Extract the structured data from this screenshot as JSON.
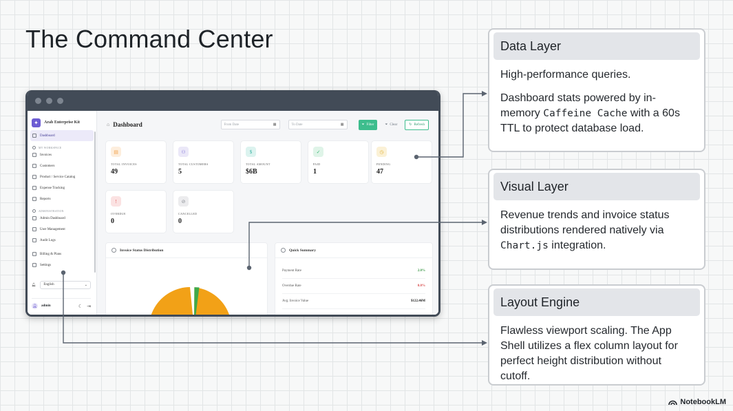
{
  "slide": {
    "title": "The Command Center",
    "watermark": "NotebookLM"
  },
  "app": {
    "brand": "Arab Enterprise Kit",
    "sidebar": {
      "dashboard": "Dashboard",
      "section_workspace": "MY WORKSPACE",
      "workspace_items": [
        "Invoices",
        "Customers",
        "Product / Service Catalog",
        "Expense Tracking",
        "Reports"
      ],
      "section_admin": "ADMINISTRATION",
      "admin_items": [
        "Admin Dashboard",
        "User Management",
        "Audit Logs"
      ],
      "billing": "Billing & Plans",
      "settings": "Settings",
      "language": "English",
      "user": "admin"
    },
    "topbar": {
      "title": "Dashboard",
      "from_placeholder": "From Date",
      "to_placeholder": "To Date",
      "filter": "Filter",
      "clear": "Clear",
      "refresh": "Refresh"
    },
    "stats": [
      {
        "label": "TOTAL INVOICES",
        "value": "49",
        "color": "#f3a24a",
        "bg": "#fdeedd",
        "icon": "document-icon"
      },
      {
        "label": "TOTAL CUSTOMERS",
        "value": "5",
        "color": "#7c6cd6",
        "bg": "#ebe8f8",
        "icon": "users-icon"
      },
      {
        "label": "TOTAL AMOUNT",
        "value": "$6B",
        "color": "#3bb3a4",
        "bg": "#dcf3ef",
        "icon": "dollar-icon"
      },
      {
        "label": "PAID",
        "value": "1",
        "color": "#3fb978",
        "bg": "#dff4e8",
        "icon": "check-circle-icon"
      },
      {
        "label": "PENDING",
        "value": "47",
        "color": "#e2b43a",
        "bg": "#fbf1d6",
        "icon": "clock-icon"
      },
      {
        "label": "OVERDUE",
        "value": "0",
        "color": "#e05a5a",
        "bg": "#fbe2e2",
        "icon": "alert-icon"
      },
      {
        "label": "CANCELLED",
        "value": "0",
        "color": "#8a8f96",
        "bg": "#ececee",
        "icon": "cancel-icon"
      }
    ],
    "invoice_panel": {
      "title": "Invoice Status Distribution",
      "pie_colors": [
        "#f2a117",
        "#3fa94a"
      ]
    },
    "summary_panel": {
      "title": "Quick Summary",
      "rows": [
        {
          "label": "Payment Rate",
          "value": "2.0%",
          "color": "#3f9a4a"
        },
        {
          "label": "Overdue Rate",
          "value": "0.0%",
          "color": "#d84d4d"
        },
        {
          "label": "Avg. Invoice Value",
          "value": "$122.46M",
          "color": "#222222"
        }
      ]
    }
  },
  "callouts": [
    {
      "heading": "Data Layer",
      "p1": "High-performance queries.",
      "p2_pre": "Dashboard stats powered by in-memory ",
      "p2_code": "Caffeine Cache",
      "p2_post": " with a 60s TTL to protect database load."
    },
    {
      "heading": "Visual Layer",
      "p1_pre": "Revenue trends and invoice status distributions rendered natively via ",
      "p1_code": "Chart.js",
      "p1_post": " integration."
    },
    {
      "heading": "Layout Engine",
      "p1": "Flawless viewport scaling. The App Shell utilizes a flex column layout for perfect height distribution without cutoff."
    }
  ],
  "colors": {
    "accent_green": "#3dbd8d",
    "brand_purple": "#6d5dd3",
    "window_frame": "#424b57",
    "connector": "#5b6470"
  }
}
